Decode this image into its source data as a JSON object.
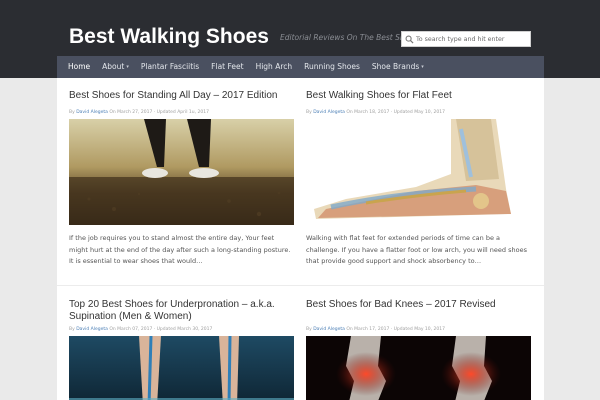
{
  "site": {
    "title": "Best Walking Shoes",
    "tagline": "Editorial Reviews On The Best Shoes",
    "search_placeholder": "To search type and hit enter"
  },
  "nav": {
    "items": [
      {
        "label": "Home",
        "active": true,
        "dropdown": false
      },
      {
        "label": "About",
        "active": false,
        "dropdown": true
      },
      {
        "label": "Plantar Fasciitis",
        "active": false,
        "dropdown": false
      },
      {
        "label": "Flat Feet",
        "active": false,
        "dropdown": false
      },
      {
        "label": "High Arch",
        "active": false,
        "dropdown": false
      },
      {
        "label": "Running Shoes",
        "active": false,
        "dropdown": false
      },
      {
        "label": "Shoe Brands",
        "active": false,
        "dropdown": true
      }
    ],
    "caret": "▾"
  },
  "posts": [
    {
      "title": "Best Shoes for Standing All Day – 2017 Edition",
      "by": "By",
      "author": "David Alegeta",
      "meta": "On March 27, 2017 · Updated April 1u, 2017",
      "image": "feet-standing-photo",
      "excerpt": "If the job requires you to stand almost the entire day, Your feet might hurt at the end of the day after such a long-standing posture. It is essential to wear shoes that would…"
    },
    {
      "title": "Best Walking Shoes for Flat Feet",
      "by": "By",
      "author": "David Alegeta",
      "meta": "On March 18, 2017 · Updated May 10, 2017",
      "image": "foot-anatomy-model",
      "excerpt": "Walking with flat feet for extended periods of time can be a challenge. If you have a flatter foot or low arch, you will need shoes that provide good support and shock absorbency to…"
    },
    {
      "title": "Top 20 Best Shoes for Underpronation – a.k.a. Supination (Men & Women)",
      "by": "By",
      "author": "David Alegeta",
      "meta": "On March 07, 2017 · Updated March 30, 2017",
      "image": "legs-gait-analysis"
    },
    {
      "title": "Best Shoes for Bad Knees – 2017 Revised",
      "by": "By",
      "author": "David Alegeta",
      "meta": "On March 17, 2017 · Updated May 10, 2017",
      "image": "knee-xray"
    }
  ]
}
